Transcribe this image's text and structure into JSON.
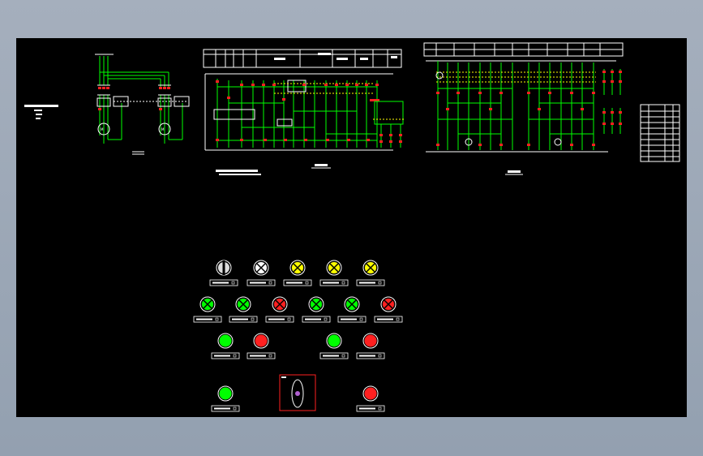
{
  "drawing": {
    "background": "#000000",
    "line_colors": {
      "wire": "#ffffff",
      "circuit": "#00ff00",
      "node": "#ff2020",
      "accent": "#ffff00",
      "frame": "#ffffff"
    },
    "motor_note": "",
    "circuit1_caption": "",
    "circuit2_caption": "",
    "panel_caption": ""
  },
  "panel": {
    "row1": [
      {
        "icon": "selector-switch-icon",
        "color": "#ffffff"
      },
      {
        "icon": "indicator-lamp-icon",
        "color": "#ffffff"
      },
      {
        "icon": "indicator-lamp-icon",
        "color": "#ffff00"
      },
      {
        "icon": "indicator-lamp-icon",
        "color": "#ffff00"
      },
      {
        "icon": "indicator-lamp-icon",
        "color": "#ffff00"
      }
    ],
    "row2": [
      {
        "icon": "indicator-lamp-icon",
        "color": "#00ff00"
      },
      {
        "icon": "indicator-lamp-icon",
        "color": "#00ff00"
      },
      {
        "icon": "indicator-lamp-icon",
        "color": "#ff2020"
      },
      {
        "icon": "indicator-lamp-icon",
        "color": "#00ff00"
      },
      {
        "icon": "indicator-lamp-icon",
        "color": "#00ff00"
      },
      {
        "icon": "indicator-lamp-icon",
        "color": "#ff2020"
      }
    ],
    "row3": [
      {
        "icon": "push-button-icon",
        "color": "#00ff00"
      },
      {
        "icon": "push-button-icon",
        "color": "#ff2020"
      },
      {
        "icon": "push-button-icon",
        "color": "#00ff00"
      },
      {
        "icon": "push-button-icon",
        "color": "#ff2020"
      }
    ],
    "row4": [
      {
        "icon": "push-button-icon",
        "color": "#00ff00"
      },
      {
        "icon": "emergency-selector-icon",
        "color": "#ff2020"
      },
      {
        "icon": "push-button-icon",
        "color": "#ff2020"
      }
    ]
  }
}
